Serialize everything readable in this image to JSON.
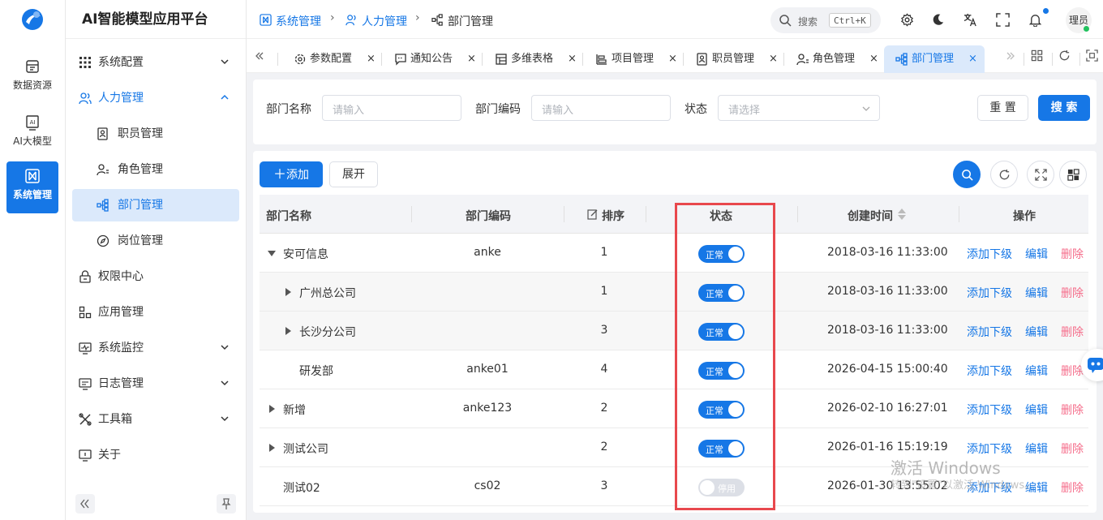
{
  "app": {
    "title": "AI智能模型应用平台"
  },
  "rail": {
    "items": [
      {
        "label": "数据资源",
        "icon": "database-icon"
      },
      {
        "label": "AI大模型",
        "icon": "ai-icon"
      },
      {
        "label": "系统管理",
        "icon": "system-icon",
        "active": true
      }
    ]
  },
  "sidebar": {
    "items": [
      {
        "label": "系统配置",
        "icon": "grid-icon"
      },
      {
        "label": "人力管理",
        "icon": "users-icon",
        "open": true
      },
      {
        "label": "职员管理",
        "icon": "staff-icon"
      },
      {
        "label": "角色管理",
        "icon": "role-icon"
      },
      {
        "label": "部门管理",
        "icon": "org-icon",
        "active": true
      },
      {
        "label": "岗位管理",
        "icon": "compass-icon"
      },
      {
        "label": "权限中心",
        "icon": "lock-icon"
      },
      {
        "label": "应用管理",
        "icon": "apps-icon"
      },
      {
        "label": "系统监控",
        "icon": "monitor-icon"
      },
      {
        "label": "日志管理",
        "icon": "log-icon"
      },
      {
        "label": "工具箱",
        "icon": "tools-icon"
      },
      {
        "label": "关于",
        "icon": "about-icon"
      }
    ]
  },
  "breadcrumb": {
    "items": [
      "系统管理",
      "人力管理",
      "部门管理"
    ]
  },
  "topbar": {
    "search_label": "搜索",
    "search_shortcut": "Ctrl+K",
    "user": "理员"
  },
  "tabs": {
    "items": [
      {
        "label": "参数配置",
        "icon": "settings-icon"
      },
      {
        "label": "通知公告",
        "icon": "message-icon"
      },
      {
        "label": "多维表格",
        "icon": "table-icon"
      },
      {
        "label": "项目管理",
        "icon": "project-icon"
      },
      {
        "label": "职员管理",
        "icon": "staff-icon"
      },
      {
        "label": "角色管理",
        "icon": "role-icon"
      },
      {
        "label": "部门管理",
        "icon": "org-icon",
        "active": true
      }
    ]
  },
  "filter": {
    "name_label": "部门名称",
    "name_placeholder": "请输入",
    "code_label": "部门编码",
    "code_placeholder": "请输入",
    "status_label": "状态",
    "status_placeholder": "请选择",
    "reset_label": "重 置",
    "search_label": "搜 索"
  },
  "toolbar": {
    "add_label": "添加",
    "expand_label": "展开"
  },
  "table": {
    "headers": {
      "name": "部门名称",
      "code": "部门编码",
      "sort": "排序",
      "status": "状态",
      "created": "创建时间",
      "action": "操作"
    },
    "rows": [
      {
        "name": "安可信息",
        "code": "anke",
        "sort": "1",
        "status": "正常",
        "on": true,
        "created": "2018-03-16 11:33:00",
        "level": 0,
        "caret": "down"
      },
      {
        "name": "广州总公司",
        "code": "",
        "sort": "1",
        "status": "正常",
        "on": true,
        "created": "2018-03-16 11:33:00",
        "level": 1,
        "caret": "right"
      },
      {
        "name": "长沙分公司",
        "code": "",
        "sort": "3",
        "status": "正常",
        "on": true,
        "created": "2018-03-16 11:33:00",
        "level": 1,
        "caret": "right"
      },
      {
        "name": "研发部",
        "code": "anke01",
        "sort": "4",
        "status": "正常",
        "on": true,
        "created": "2026-04-15 15:00:40",
        "level": 1,
        "caret": "none"
      },
      {
        "name": "新增",
        "code": "anke123",
        "sort": "2",
        "status": "正常",
        "on": true,
        "created": "2026-02-10 16:27:01",
        "level": 0,
        "caret": "right"
      },
      {
        "name": "测试公司",
        "code": "",
        "sort": "2",
        "status": "正常",
        "on": true,
        "created": "2026-01-16 15:19:19",
        "level": 0,
        "caret": "right"
      },
      {
        "name": "测试02",
        "code": "cs02",
        "sort": "3",
        "status": "停用",
        "on": false,
        "created": "2026-01-30 13:55:02",
        "level": 0,
        "caret": "none"
      }
    ],
    "actions": {
      "add_child": "添加下级",
      "edit": "编辑",
      "delete": "删除"
    }
  },
  "watermark": {
    "line1": "激活 Windows",
    "line2": "转到\"设置\"以激活 Windows。"
  },
  "colors": {
    "primary": "#1677e6",
    "danger": "#f56c8a",
    "highlight": "#e8484d"
  }
}
